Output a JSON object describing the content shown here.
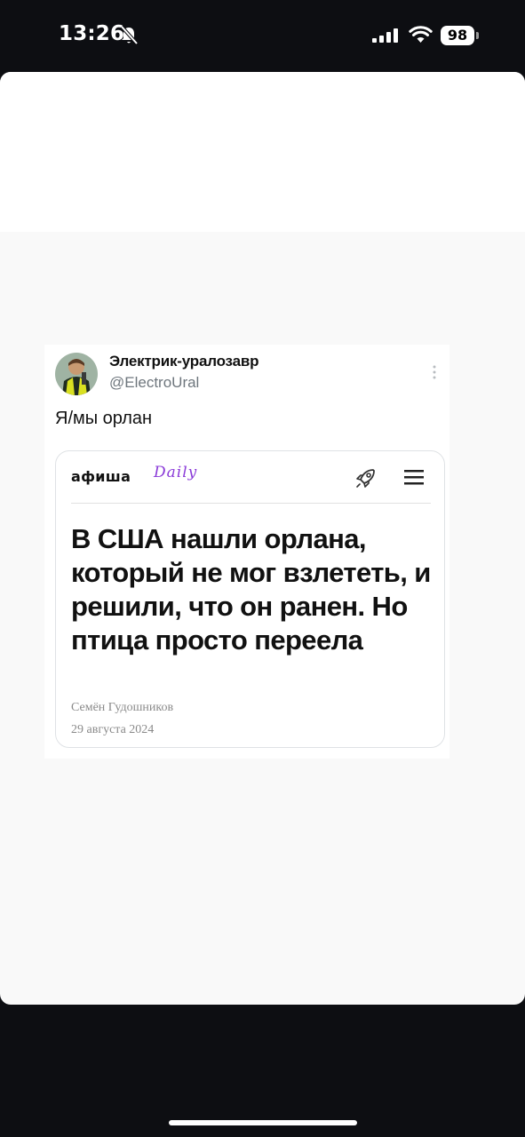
{
  "status_bar": {
    "time": "13:26",
    "battery_level": "98",
    "signal_bars": 4,
    "icons": [
      "bell-slash-icon",
      "signal-icon",
      "wifi-icon",
      "battery-icon"
    ]
  },
  "tweet": {
    "author_name": "Электрик-уралозавр",
    "author_handle": "@ElectroUral",
    "text": "Я/мы орлан",
    "icons": [
      "avatar",
      "more-vertical-icon"
    ]
  },
  "article_card": {
    "logo_text": "афиша",
    "logo_suffix": "Daily",
    "headline": "В США нашли орлана, который не мог взлететь, и решили, что он ранен. Но птица просто переела",
    "author": "Семён Гудошников",
    "date": "29 августа 2024",
    "icons": [
      "rocket-icon",
      "hamburger-menu-icon"
    ],
    "accent_color": "#8a3ad8"
  },
  "colors": {
    "background": "#0d0e12",
    "sheet": "#f9f9f9",
    "text": "#111111",
    "muted": "#6e767d"
  }
}
